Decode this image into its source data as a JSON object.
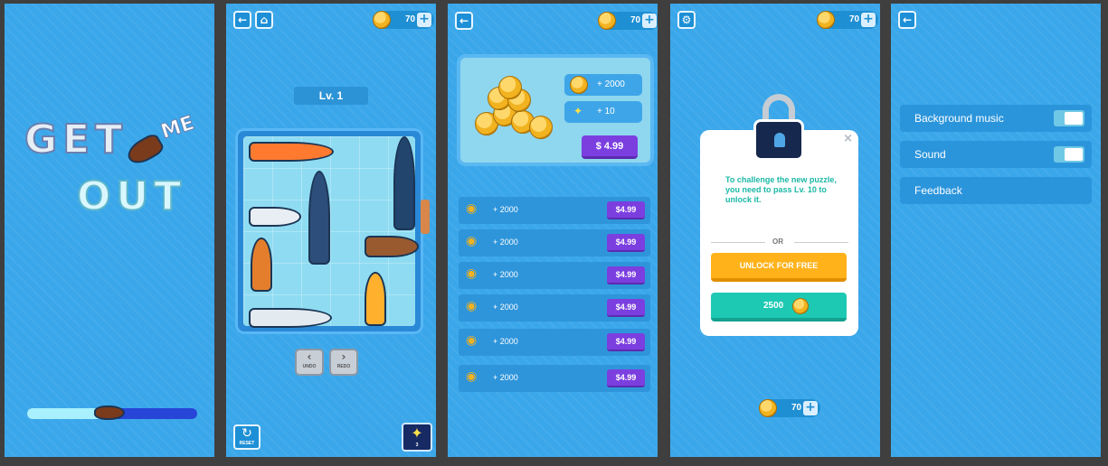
{
  "splash": {
    "logo_get": "GET",
    "logo_me": "ME",
    "logo_out": "OUT",
    "loading_progress": 0.5
  },
  "level_screen": {
    "coins": "70",
    "level_label": "Lv. 1",
    "undo_label": "UNDO",
    "redo_label": "REDO",
    "reset_label": "RESET",
    "hint_count": "3"
  },
  "shop": {
    "coins": "70",
    "featured": {
      "coin_amount": "+ 2000",
      "hint_amount": "+ 10",
      "price": "$ 4.99"
    },
    "packs": [
      {
        "amount": "+ 2000",
        "price": "$4.99"
      },
      {
        "amount": "+ 2000",
        "price": "$4.99"
      },
      {
        "amount": "+ 2000",
        "price": "$4.99"
      },
      {
        "amount": "+ 2000",
        "price": "$4.99"
      },
      {
        "amount": "+ 2000",
        "price": "$4.99"
      },
      {
        "amount": "+ 2000",
        "price": "$4.99"
      }
    ]
  },
  "locked_dialog": {
    "coins": "70",
    "close": "×",
    "message": "To challenge the new puzzle, you need to pass Lv. 10 to unlock it.",
    "or": "OR",
    "unlock_free": "UNLOCK FOR FREE",
    "cost": "2500",
    "bottom_coins": "70"
  },
  "settings": {
    "items": [
      {
        "label": "Background music",
        "toggle": true
      },
      {
        "label": "Sound",
        "toggle": true
      },
      {
        "label": "Feedback",
        "toggle": false
      }
    ]
  },
  "icons": {
    "back": "←",
    "home": "⌂",
    "gear": "⚙",
    "plus": "+",
    "bulb": "💡",
    "reset": "↻"
  }
}
